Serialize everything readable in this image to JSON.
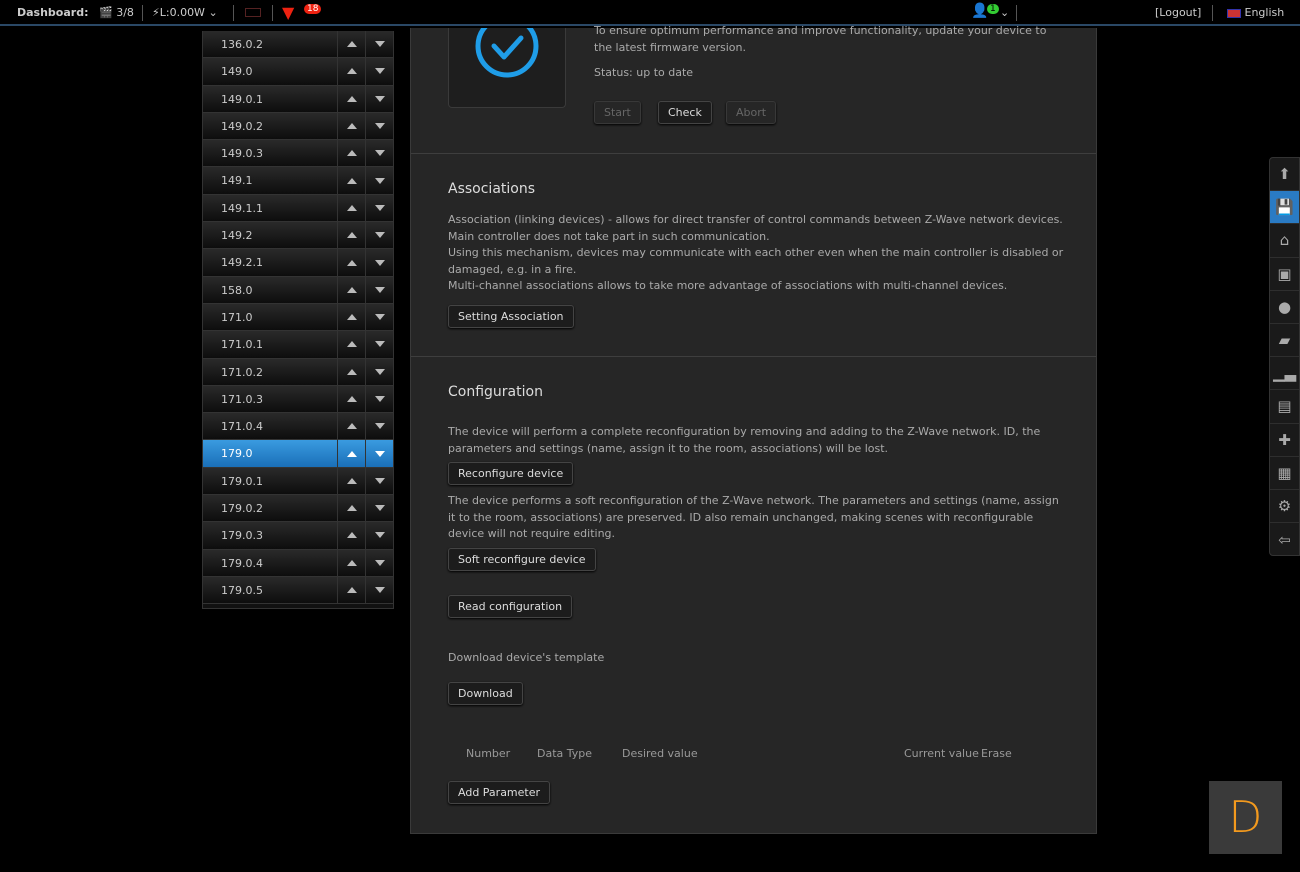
{
  "topbar": {
    "dashboard_label": "Dashboard:",
    "scenes": "3/8",
    "power": "L:0.00W",
    "alerts_count": "18",
    "user_badge": "1",
    "logout": "[Logout]",
    "language": "English"
  },
  "devices": [
    "136.0.2",
    "149.0",
    "149.0.1",
    "149.0.2",
    "149.0.3",
    "149.1",
    "149.1.1",
    "149.2",
    "149.2.1",
    "158.0",
    "171.0",
    "171.0.1",
    "171.0.2",
    "171.0.3",
    "171.0.4",
    "179.0",
    "179.0.1",
    "179.0.2",
    "179.0.3",
    "179.0.4",
    "179.0.5"
  ],
  "selected_device": "179.0",
  "firmware": {
    "description": "To ensure optimum performance and improve functionality, update your device to the latest firmware version.",
    "status": "Status: up to date",
    "start": "Start",
    "check": "Check",
    "abort": "Abort"
  },
  "associations": {
    "title": "Associations",
    "line1": "Association (linking devices) - allows for direct transfer of control commands between Z-Wave network devices. Main controller does not take part in such communication.",
    "line2": "Using this mechanism, devices may communicate with each other even when the main controller is disabled or damaged, e.g. in a fire.",
    "line3": "Multi-channel associations allows to take more advantage of associations with multi-channel devices.",
    "button": "Setting Association"
  },
  "configuration": {
    "title": "Configuration",
    "reconf_text": "The device will perform a complete reconfiguration by removing and adding to the Z-Wave network. ID, the parameters and settings (name, assign it to the room, associations) will be lost.",
    "reconf_button": "Reconfigure device",
    "soft_text": "The device performs a soft reconfiguration of the Z-Wave network. The parameters and settings (name, assign it to the room, associations) are preserved. ID also remain unchanged, making scenes with reconfigurable device will not require editing.",
    "soft_button": "Soft reconfigure device",
    "read_button": "Read configuration",
    "template_label": "Download device's template",
    "download_button": "Download",
    "columns": [
      "Number",
      "Data Type",
      "Desired value",
      "Current value",
      "Erase"
    ],
    "add_button": "Add Parameter"
  },
  "logo_letter": "D"
}
